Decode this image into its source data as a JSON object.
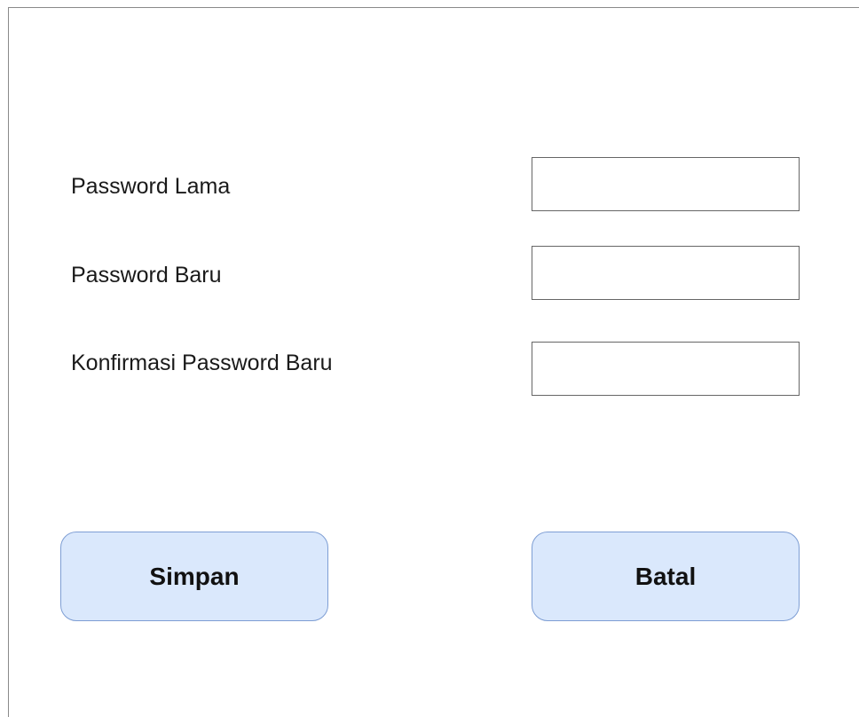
{
  "form": {
    "old_password": {
      "label": "Password Lama",
      "value": ""
    },
    "new_password": {
      "label": "Password Baru",
      "value": ""
    },
    "confirm_password": {
      "label": "Konfirmasi Password Baru",
      "value": ""
    }
  },
  "buttons": {
    "save_label": "Simpan",
    "cancel_label": "Batal"
  },
  "colors": {
    "button_fill": "#dae8fc",
    "button_border": "#7e9ed4",
    "field_border": "#666666"
  }
}
